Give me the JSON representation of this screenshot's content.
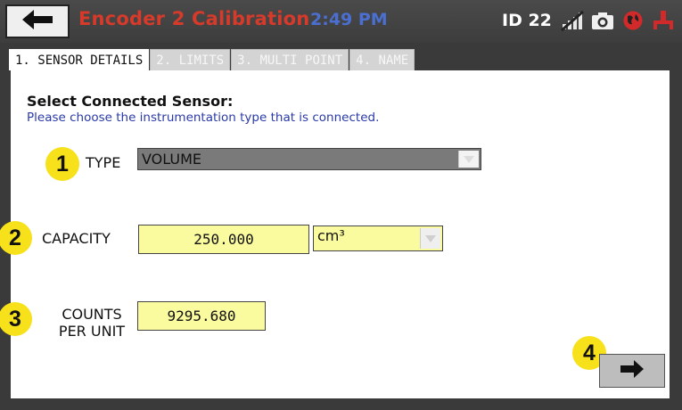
{
  "header": {
    "title": "Encoder 2 Calibration",
    "time": "2:49 PM",
    "id_label": "ID 22",
    "icons": [
      "back-arrow-icon",
      "wireless-off-icon",
      "camera-icon",
      "globe-icon",
      "network-icon"
    ]
  },
  "tabs": [
    {
      "label": "1. SENSOR DETAILS",
      "active": true
    },
    {
      "label": "2. LIMITS",
      "active": false
    },
    {
      "label": "3. MULTI POINT",
      "active": false
    },
    {
      "label": "4. NAME",
      "active": false
    }
  ],
  "form": {
    "heading": "Select Connected Sensor:",
    "subheading": "Please choose the instrumentation type that is connected.",
    "type": {
      "label": "TYPE",
      "value": "VOLUME"
    },
    "capacity": {
      "label": "CAPACITY",
      "value": "250.000",
      "unit": "cm³"
    },
    "counts": {
      "label_line1": "COUNTS",
      "label_line2": "PER UNIT",
      "value": "9295.680"
    }
  },
  "markers": [
    "1",
    "2",
    "3",
    "4"
  ],
  "colors": {
    "title": "#d63a2a",
    "time": "#4a6fd0",
    "subheading": "#2a3aa8",
    "marker": "#f7e11a",
    "field": "#fafa9e",
    "type_select": "#7a7a7a"
  }
}
